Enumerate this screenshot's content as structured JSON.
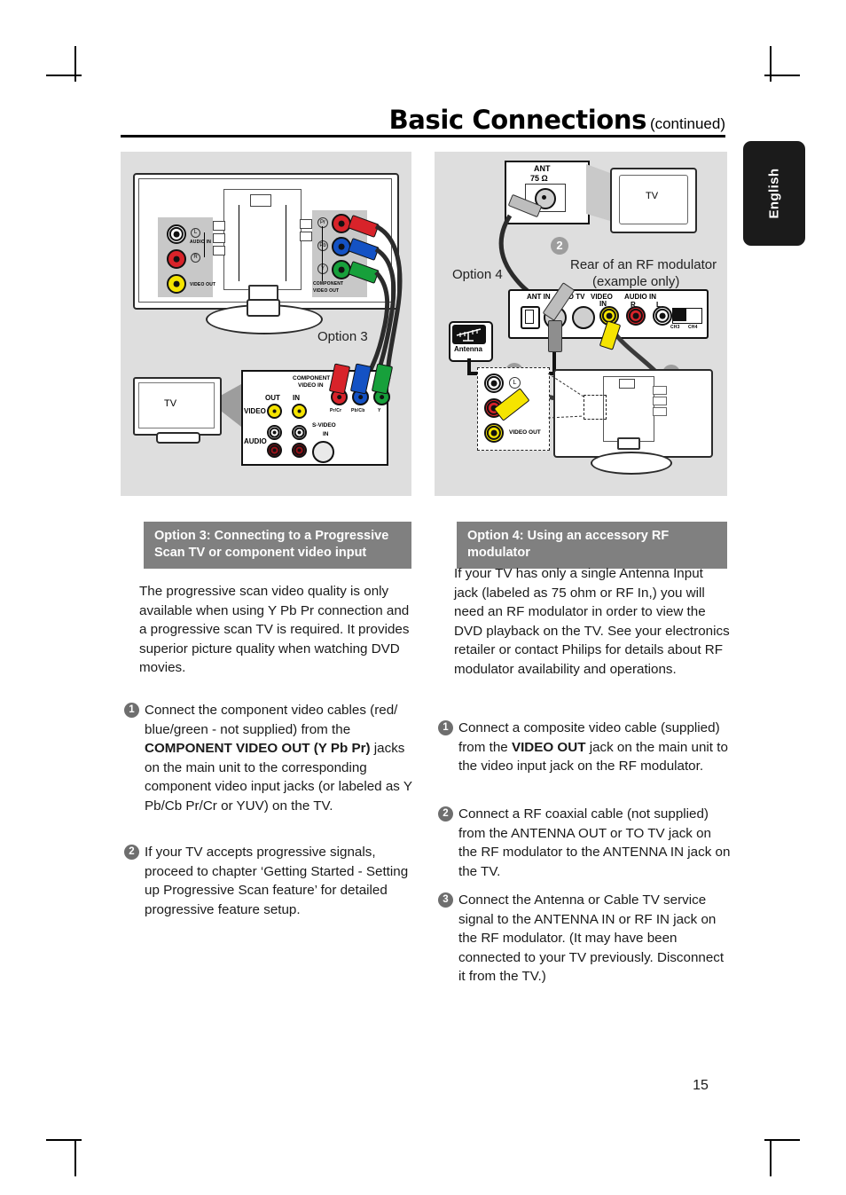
{
  "header": {
    "title": "Basic Connections",
    "continued": "(continued)"
  },
  "language_tab": {
    "label": "English"
  },
  "page_number": "15",
  "diagram_left": {
    "caption": "Option 3",
    "main_unit": {
      "audio_in_label": "AUDIO IN",
      "audio_in_l": "L",
      "audio_in_r": "R",
      "video_out_label": "VIDEO OUT",
      "component_label": "COMPONENT\nVIDEO OUT",
      "component_line1": "COMPONENT",
      "component_line2": "VIDEO OUT",
      "pr": "Pr",
      "pb": "Pb",
      "y": "Y"
    },
    "tv": {
      "screen_label": "TV",
      "component_video_in_line1": "COMPONENT",
      "component_video_in_line2": "VIDEO IN",
      "out": "OUT",
      "in": "IN",
      "video": "VIDEO",
      "audio": "AUDIO",
      "svideo_line1": "S-VIDEO",
      "svideo_line2": "IN",
      "jack_pr": "Pr/Cr",
      "jack_pb": "Pb/Cb",
      "jack_y": "Y"
    }
  },
  "diagram_right": {
    "caption": "Option 4",
    "modulator_title_line1": "Rear of an RF modulator",
    "modulator_title_line2": "(example only)",
    "tv": {
      "screen_label": "TV",
      "ant_line1": "ANT",
      "ant_line2": "75 Ω"
    },
    "modulator_panel": {
      "ant_in": "ANT IN",
      "to_tv": "TO TV",
      "video_in_line1": "VIDEO",
      "video_in_line2": "IN",
      "audio_in": "AUDIO IN",
      "audio_r": "R",
      "audio_l": "L",
      "ch3": "CH3",
      "ch4": "CH4"
    },
    "antenna_icon_label": "Antenna",
    "main_unit": {
      "video_out_label": "VIDEO OUT",
      "audio_l": "L"
    },
    "step_markers": [
      "1",
      "2",
      "3"
    ]
  },
  "left_column": {
    "section_heading": "Option 3: Connecting to a Progressive Scan TV or component video input",
    "intro": "The progressive scan video quality is only available when using Y Pb Pr connection and a progressive scan TV is required. It provides superior picture quality when watching DVD movies.",
    "steps": [
      {
        "number": "1",
        "parts": [
          {
            "text": "Connect the component video cables (red/ blue/green - not supplied) from the ",
            "bold": false
          },
          {
            "text": "COMPONENT VIDEO OUT (Y Pb Pr)",
            "bold": true
          },
          {
            "text": " jacks on the main unit to the corresponding component video input jacks (or labeled as Y Pb/Cb Pr/Cr or YUV) on the TV.",
            "bold": false
          }
        ]
      },
      {
        "number": "2",
        "parts": [
          {
            "text": "If your TV accepts progressive signals, proceed to chapter ‘Getting Started - Setting up Progressive Scan feature’ for detailed progressive feature setup.",
            "bold": false
          }
        ]
      }
    ]
  },
  "right_column": {
    "section_heading": "Option 4: Using an accessory RF modulator",
    "intro": "If your TV has only a single Antenna Input jack (labeled as 75 ohm or RF In,) you will need an RF modulator in order to view the DVD playback on the TV.  See your electronics retailer or contact Philips for details about RF modulator availability and operations.",
    "steps": [
      {
        "number": "1",
        "parts": [
          {
            "text": "Connect a composite video cable (supplied) from the ",
            "bold": false
          },
          {
            "text": "VIDEO OUT",
            "bold": true
          },
          {
            "text": " jack on the main unit to the video input jack on the RF modulator.",
            "bold": false
          }
        ]
      },
      {
        "number": "2",
        "parts": [
          {
            "text": "Connect a RF coaxial cable (not supplied) from the ANTENNA OUT or TO TV jack on the RF modulator to the ANTENNA IN jack on the TV.",
            "bold": false
          }
        ]
      },
      {
        "number": "3",
        "parts": [
          {
            "text": "Connect the Antenna or Cable TV service signal to the ANTENNA IN or RF IN jack on the RF modulator.  (It may have been connected to your TV previously.  Disconnect it from the TV.)",
            "bold": false
          }
        ]
      }
    ]
  },
  "colors": {
    "section_bar": "#808080",
    "tab": "#1b1b1b",
    "red": "#d8232a",
    "green": "#17a03b",
    "blue": "#1452c4",
    "yellow": "#f5e400"
  }
}
